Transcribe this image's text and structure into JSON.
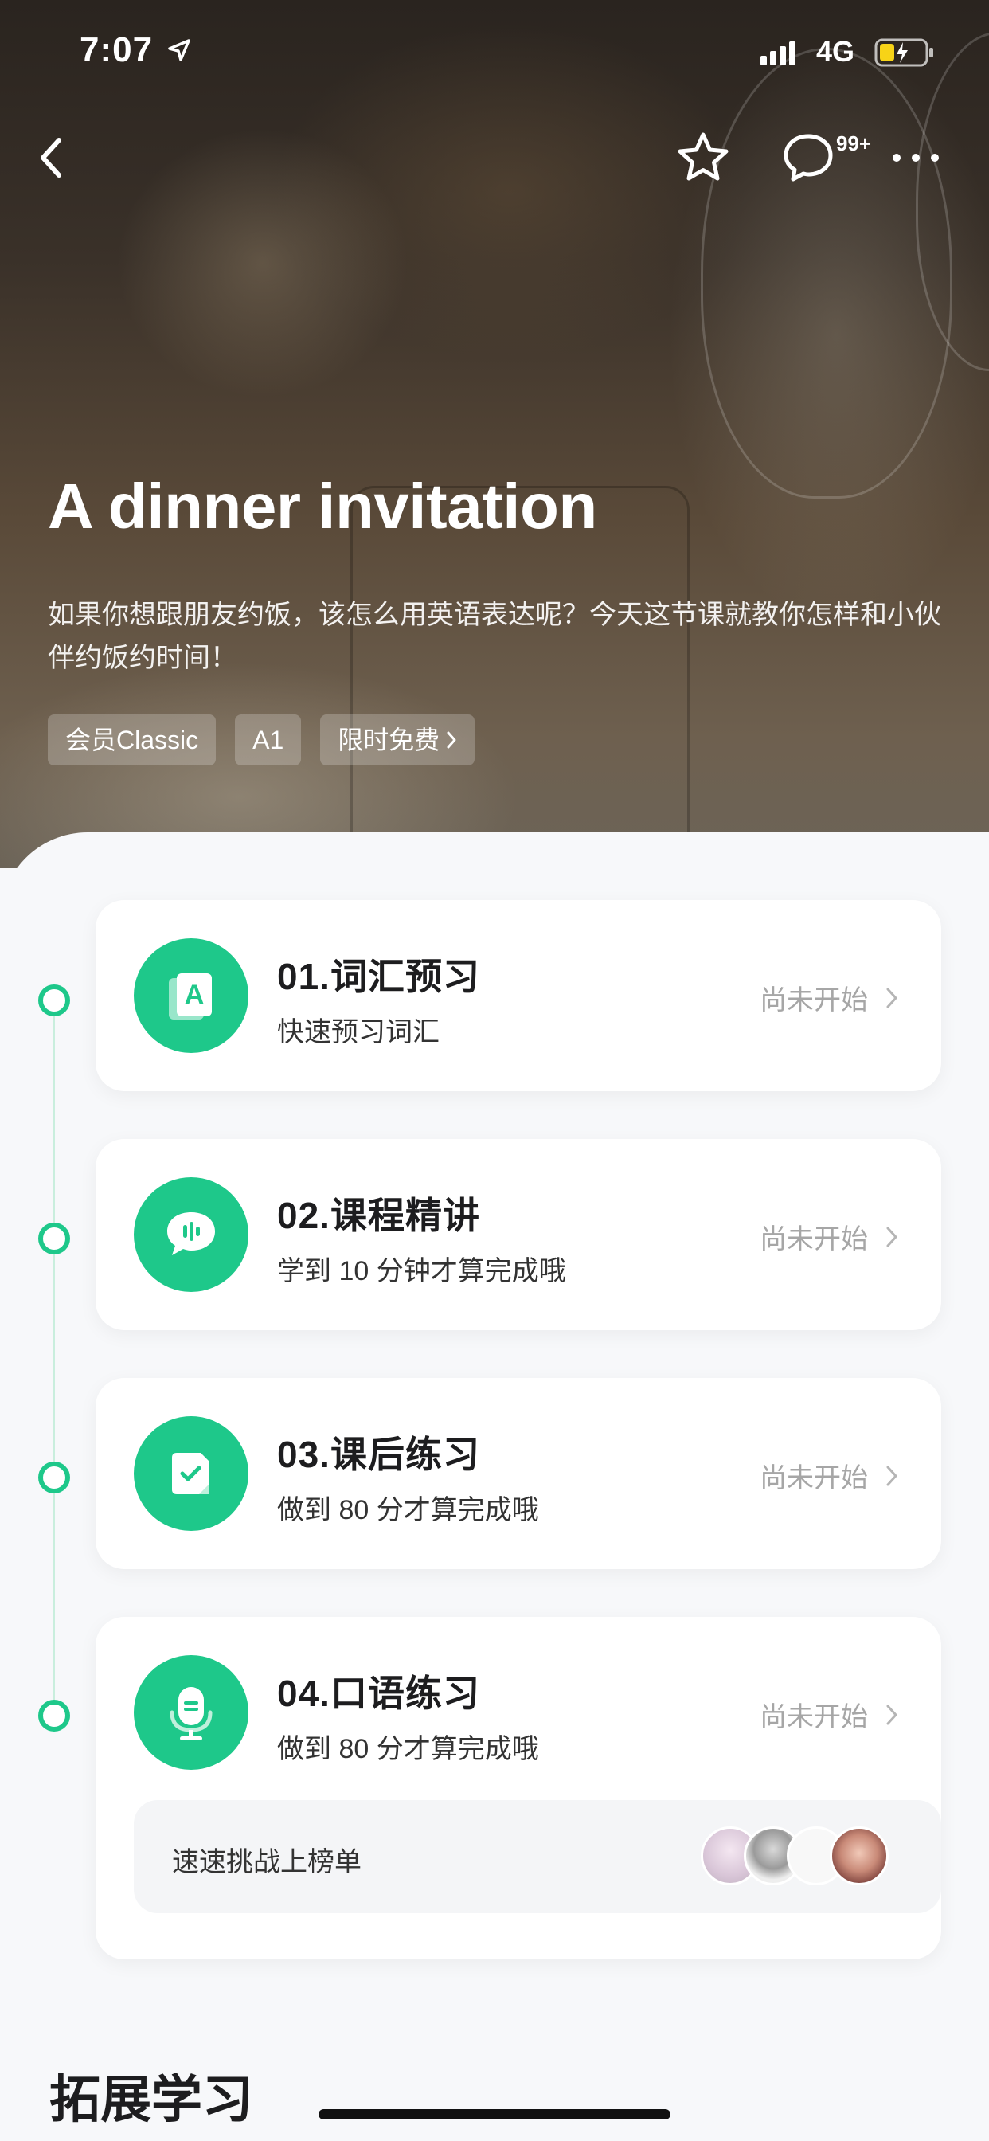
{
  "status_bar": {
    "time": "7:07",
    "network": "4G"
  },
  "nav": {
    "comment_badge": "99+"
  },
  "lesson": {
    "title": "A dinner invitation",
    "description": "如果你想跟朋友约饭，该怎么用英语表达呢？今天这节课就教你怎样和小伙伴约饭约时间！",
    "tags": [
      "会员Classic",
      "A1",
      "限时免费"
    ]
  },
  "steps": [
    {
      "title": "01.词汇预习",
      "subtitle": "快速预习词汇",
      "status": "尚未开始",
      "icon": "vocabulary-icon"
    },
    {
      "title": "02.课程精讲",
      "subtitle": "学到 10 分钟才算完成哦",
      "status": "尚未开始",
      "icon": "audio-lecture-icon"
    },
    {
      "title": "03.课后练习",
      "subtitle": "做到 80 分才算完成哦",
      "status": "尚未开始",
      "icon": "exercise-check-icon"
    },
    {
      "title": "04.口语练习",
      "subtitle": "做到 80 分才算完成哦",
      "status": "尚未开始",
      "icon": "microphone-icon"
    }
  ],
  "challenge": {
    "label": "速速挑战上榜单"
  },
  "section": {
    "title": "拓展学习"
  },
  "colors": {
    "accent": "#1ec88a",
    "status_gray": "#a6a6a6"
  }
}
